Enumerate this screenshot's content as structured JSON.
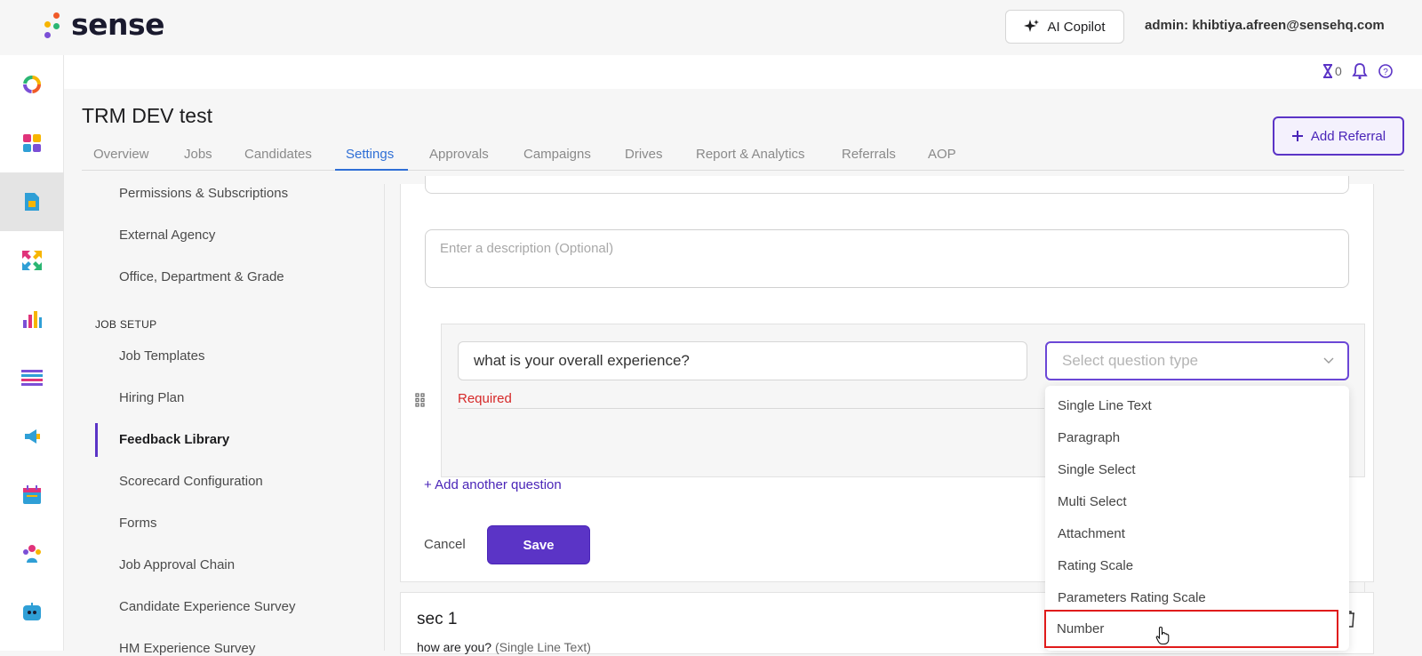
{
  "app": {
    "brand": "sense",
    "copilot_label": "AI Copilot",
    "admin_label": "admin: khibtiya.afreen@sensehq.com",
    "hourglass_count": "0"
  },
  "rail": {
    "items": [
      "sense-logo-icon",
      "apps-grid-icon",
      "jobs-document-icon",
      "referral-arrows-icon",
      "analytics-bars-icon",
      "list-icon",
      "campaign-megaphone-icon",
      "calendar-icon",
      "people-group-icon",
      "chatbot-icon"
    ],
    "active_index": 2
  },
  "page": {
    "title": "TRM DEV test",
    "add_referral_label": "Add Referral"
  },
  "tabs": [
    {
      "label": "Overview"
    },
    {
      "label": "Jobs"
    },
    {
      "label": "Candidates"
    },
    {
      "label": "Settings",
      "active": true
    },
    {
      "label": "Approvals"
    },
    {
      "label": "Campaigns"
    },
    {
      "label": "Drives"
    },
    {
      "label": "Report & Analytics"
    },
    {
      "label": "Referrals"
    },
    {
      "label": "AOP"
    }
  ],
  "subnav": {
    "items_top": [
      "Permissions & Subscriptions",
      "External Agency",
      "Office, Department & Grade"
    ],
    "job_setup_heading": "JOB SETUP",
    "items_job_setup": [
      "Job Templates",
      "Hiring Plan",
      "Feedback Library",
      "Scorecard Configuration",
      "Forms",
      "Job Approval Chain",
      "Candidate Experience Survey",
      "HM Experience Survey"
    ],
    "active_label": "Feedback Library"
  },
  "form": {
    "description_placeholder": "Enter a description (Optional)",
    "question_value": "what is your overall experience?",
    "question_type_placeholder": "Select question type",
    "required_text": "Required",
    "add_question_label": "+ Add another question",
    "cancel_label": "Cancel",
    "save_label": "Save"
  },
  "dropdown": {
    "options": [
      "Single Line Text",
      "Paragraph",
      "Single Select",
      "Multi Select",
      "Attachment",
      "Rating Scale",
      "Parameters Rating Scale",
      "Number"
    ],
    "highlighted": "Number"
  },
  "section": {
    "title": "sec 1",
    "question_text": "how are you?",
    "question_type": "(Single Line Text)"
  },
  "colors": {
    "accent": "#5b34c6",
    "tab_active": "#2f6fd6",
    "required": "#d62828",
    "highlight_box": "#e01b1b"
  }
}
